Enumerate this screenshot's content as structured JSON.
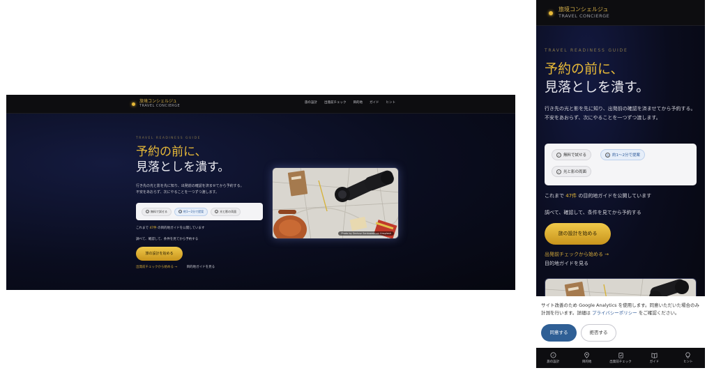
{
  "brand": {
    "name_jp": "旅境コンシェルジュ",
    "name_en": "TRAVEL CONCIERGE"
  },
  "nav": [
    "旅の設計",
    "出発前チェック",
    "目的地",
    "ガイド",
    "ヒント"
  ],
  "hero": {
    "eyebrow": "TRAVEL READINESS GUIDE",
    "title_gold": "予約の前に、",
    "title_white": "見落としを潰す。",
    "desc_line1": "行き先の光と影を先に知り、出発前の確認を済ませてから予約する。",
    "desc_line2": "不安をあおらず、次にやることを一つずつ渡します。",
    "chips": [
      "無料で試せる",
      "約1〜2分で提案",
      "光と影の両面"
    ],
    "stat_prefix": "これまで",
    "stat_count": "47件",
    "stat_suffix": "の目的地ガイドを公開しています",
    "sub": "調べて、確認して、条件を見てから予約する",
    "cta": "旅の設計を始める",
    "link_check": "出発前チェックから始める →",
    "link_guide": "目的地ガイドを見る",
    "photo_credit": "Photo by Dariusz Sankowski on Unsplash"
  },
  "consent": {
    "text_before": "サイト改善のため Google Analytics を使用します。同意いただいた場合のみ計測を行います。詳細は",
    "link": "プライバシーポリシー",
    "text_after": "をご確認ください。",
    "accept": "同意する",
    "reject": "拒否する"
  },
  "tabbar": [
    "旅の設計",
    "目的地",
    "出発前チェック",
    "ガイド",
    "ヒント"
  ],
  "colors": {
    "gold": "#e7b938",
    "navy_bg": "#0a0d1f",
    "accept_blue": "#2f5f95"
  }
}
